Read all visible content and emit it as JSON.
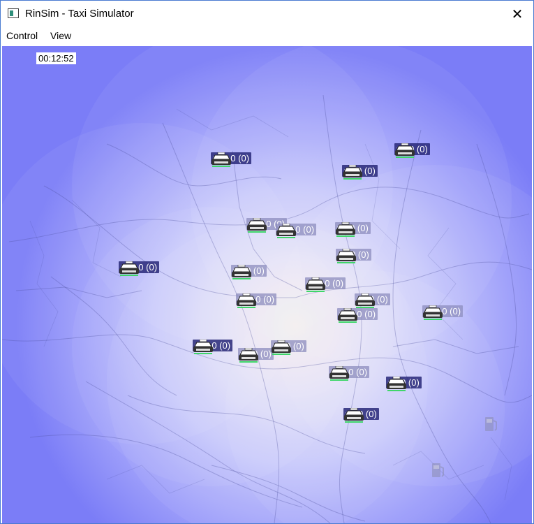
{
  "window": {
    "title": "RinSim - Taxi Simulator",
    "close_symbol": "✕"
  },
  "menu": {
    "items": [
      {
        "label": "Control"
      },
      {
        "label": "View"
      }
    ]
  },
  "map": {
    "clock": "00:12:52",
    "taxis": [
      {
        "label": "#17 0 (0)",
        "dark": true
      },
      {
        "label": "#9 0 (0)",
        "dark": true
      },
      {
        "label": "#3 0 (0)",
        "dark": true
      },
      {
        "label": "#10 0 (0)",
        "dark": false
      },
      {
        "label": "#19 0 (0)",
        "dark": false
      },
      {
        "label": "#0 0 (0)",
        "dark": false
      },
      {
        "label": "#7 0 (0)",
        "dark": false
      },
      {
        "label": "#15 0 (0)",
        "dark": true
      },
      {
        "label": "#2 0 (0)",
        "dark": false
      },
      {
        "label": "#14 0 (0)",
        "dark": false
      },
      {
        "label": "#12 0 (0)",
        "dark": false
      },
      {
        "label": "#8 0 (0)",
        "dark": false
      },
      {
        "label": "#16 0 (0)",
        "dark": false
      },
      {
        "label": "#13 0 (0)",
        "dark": false
      },
      {
        "label": "#11 0 (0)",
        "dark": true
      },
      {
        "label": "#5 0 (0)",
        "dark": false
      },
      {
        "label": "#1 0 (0)",
        "dark": false
      },
      {
        "label": "#18 0 (0)",
        "dark": false
      },
      {
        "label": "#6 0 (0)",
        "dark": true
      },
      {
        "label": "#4 0 (0)",
        "dark": true
      }
    ],
    "gas_stations": [
      {
        "icon": "fuel-pump-icon"
      },
      {
        "icon": "fuel-pump-icon"
      }
    ]
  }
}
